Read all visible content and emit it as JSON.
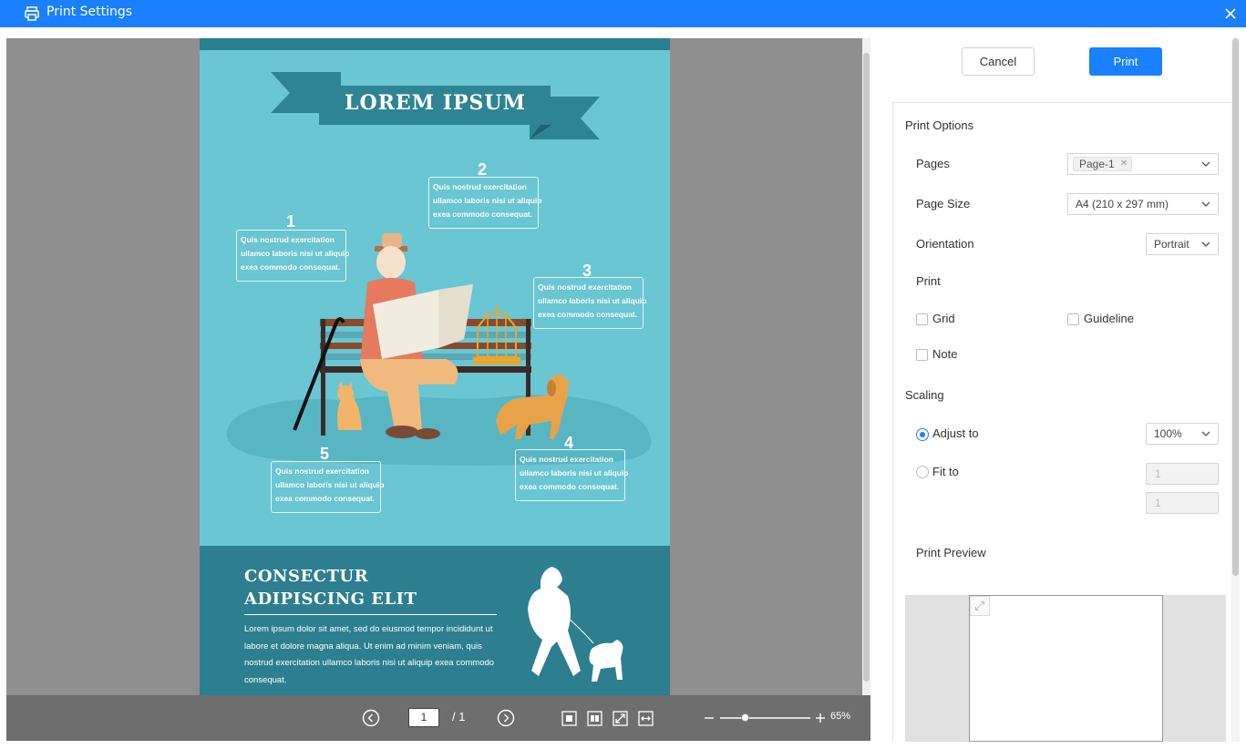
{
  "window": {
    "title": "Print Settings"
  },
  "poster": {
    "banner": "LOREM IPSUM",
    "numbers": [
      "1",
      "2",
      "3",
      "4",
      "5"
    ],
    "box1": [
      "Quis nostrud exercitation",
      "ullamco laboris nisi ut aliquip",
      "exea commodo consequat."
    ],
    "box2": [
      "Quis nostrud exercitation",
      "ullamco laboris nisi ut aliquip",
      "exea commodo consequat."
    ],
    "box3": [
      "Quis nostrud exercitation",
      "ullamco laboris nisi ut aliquip",
      "exea commodo consequat."
    ],
    "box4": [
      "Quis nostrud exercitation",
      "ullamco laboris nisi ut aliquip",
      "exea commodo consequat."
    ],
    "box5": [
      "Quis nostrud exercitation",
      "ullamco laboris nisi ut aliquip",
      "exea commodo consequat."
    ],
    "heading": [
      "CONSECTUR",
      "ADIPISCING ELIT"
    ],
    "paragraph": [
      "Lorem ipsum dolor sit amet,  sed do eiusmod tempor incididunt ut",
      "labore et dolore magna aliqua. Ut enim ad minim veniam, quis",
      "nostrud exercitation ullamco laboris nisi ut aliquip exea commodo",
      "consequat."
    ]
  },
  "viewer_toolbar": {
    "page": "1",
    "total": "/ 1",
    "zoom": "65%",
    "zoom_level": 0.28
  },
  "actions": {
    "cancel": "Cancel",
    "print": "Print"
  },
  "options": {
    "section_title": "Print Options",
    "pages_label": "Pages",
    "pages_tag": "Page-1",
    "page_size_label": "Page Size",
    "page_size_value": "A4 (210 x 297 mm)",
    "orientation_label": "Orientation",
    "orientation_value": "Portrait",
    "print_label": "Print",
    "grid_label": "Grid",
    "guideline_label": "Guideline",
    "note_label": "Note",
    "grid_checked": false,
    "guideline_checked": false,
    "note_checked": false
  },
  "scaling": {
    "title": "Scaling",
    "adjust_label": "Adjust to",
    "adjust_value": "100%",
    "fit_label": "Fit to",
    "fit_width_placeholder": "1",
    "fit_height_placeholder": "1",
    "selected": "Adjust to"
  },
  "preview": {
    "title": "Print Preview"
  },
  "colors": {
    "accent": "#1a80ff",
    "poster_bg": "#69c6d2",
    "poster_dark": "#2d7f8f"
  }
}
